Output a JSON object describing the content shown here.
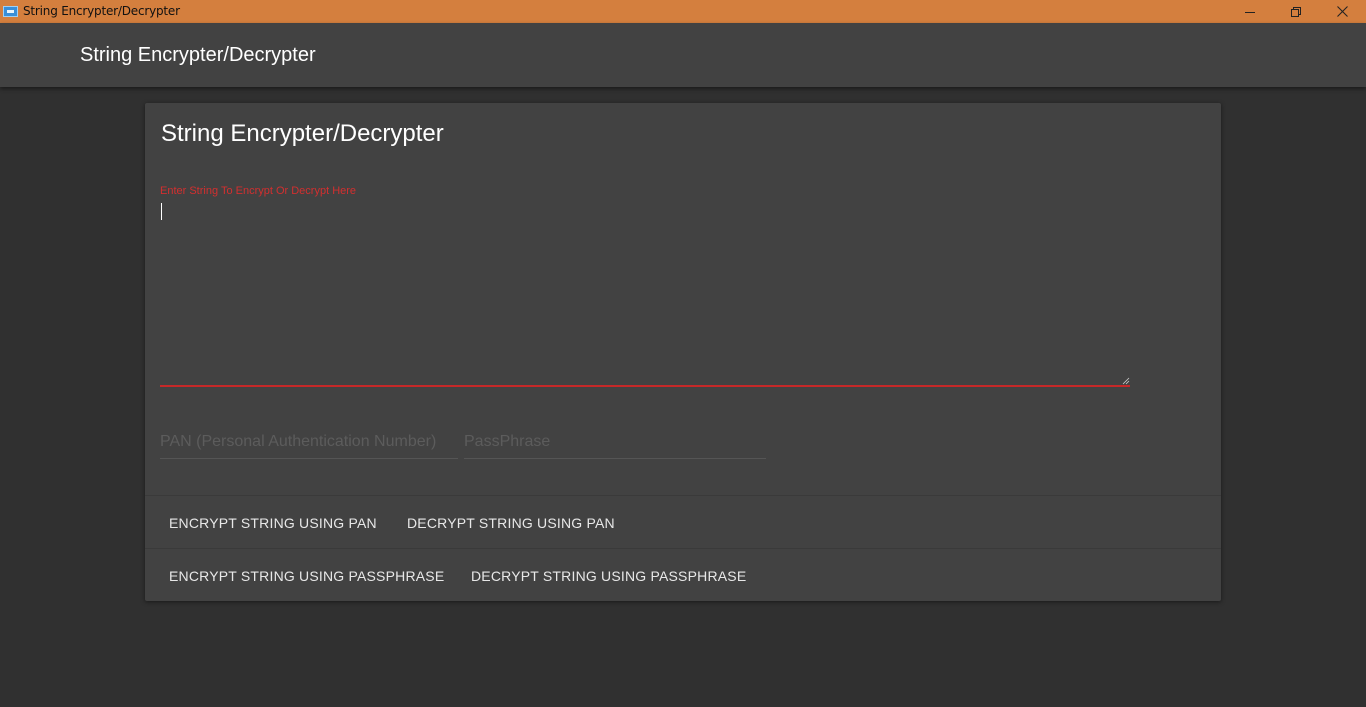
{
  "window": {
    "title": "String Encrypter/Decrypter",
    "controls": {
      "minimize": "minimize-icon",
      "maximize": "restore-icon",
      "close": "close-icon"
    },
    "titlebar_color": "#d47f3e"
  },
  "toolbar": {
    "title": "String Encrypter/Decrypter"
  },
  "card": {
    "title": "String Encrypter/Decrypter",
    "textarea": {
      "label": "Enter String To Encrypt Or Decrypt Here",
      "value": ""
    },
    "pan_field": {
      "placeholder": "PAN (Personal Authentication Number)",
      "value": ""
    },
    "passphrase_field": {
      "placeholder": "PassPhrase",
      "value": ""
    },
    "actions_row1": {
      "encrypt_pan": "ENCRYPT STRING USING PAN",
      "decrypt_pan": "DECRYPT STRING USING PAN"
    },
    "actions_row2": {
      "encrypt_passphrase": "ENCRYPT STRING USING PASSPHRASE",
      "decrypt_passphrase": "DECRYPT STRING USING PASSPHRASE"
    }
  },
  "colors": {
    "background": "#303030",
    "toolbar": "#424242",
    "card": "#424242",
    "warn": "#c62828"
  }
}
